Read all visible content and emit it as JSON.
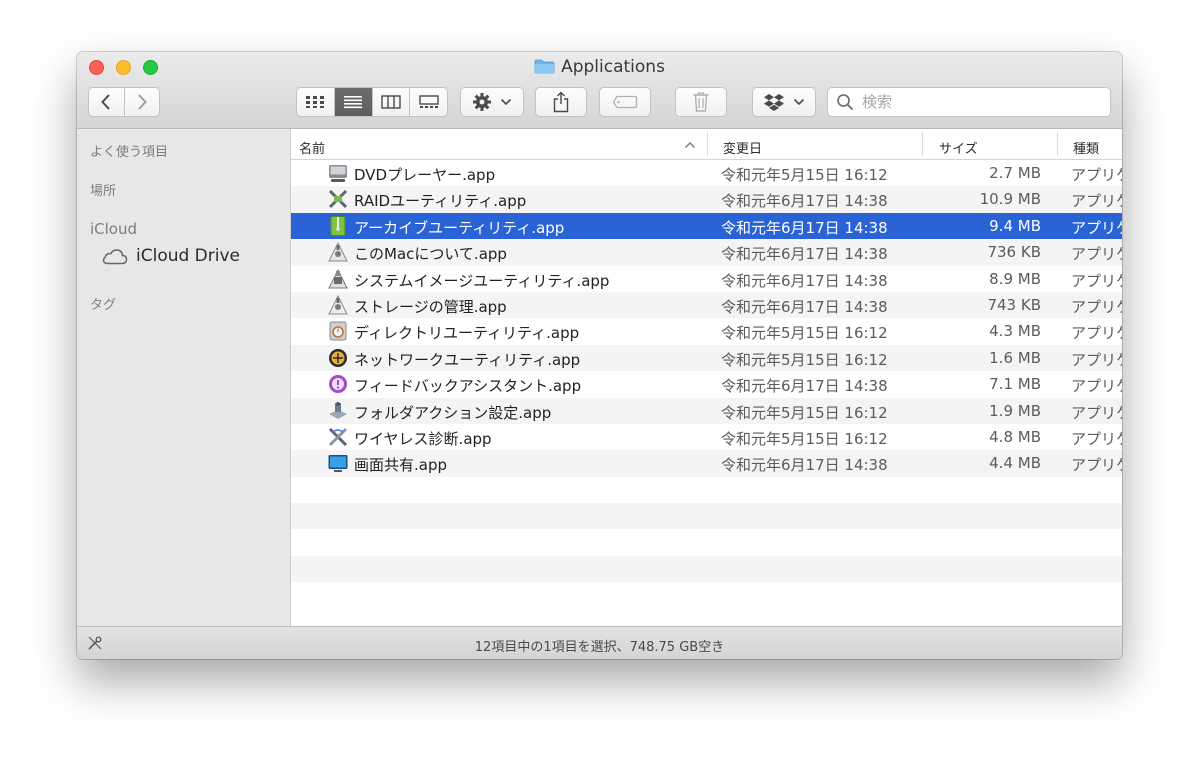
{
  "window": {
    "title": "Applications",
    "folder_icon": "folder-icon"
  },
  "toolbar": {
    "back_icon": "chevron-left-icon",
    "forward_icon": "chevron-right-icon",
    "views": [
      "icon-view-icon",
      "list-view-icon",
      "column-view-icon",
      "gallery-view-icon"
    ],
    "active_view": "list-view-icon",
    "action_icon": "gear-icon",
    "share_icon": "share-icon",
    "tag_icon": "tag-icon",
    "trash_icon": "trash-icon",
    "dropbox_icon": "dropbox-icon",
    "search_placeholder": "検索"
  },
  "sidebar": {
    "favorites_heading": "よく使う項目",
    "locations_heading": "場所",
    "icloud_heading": "iCloud",
    "icloud_drive": "iCloud Drive",
    "tags_heading": "タグ"
  },
  "columns": {
    "name": "名前",
    "modified": "変更日",
    "size": "サイズ",
    "kind": "種類"
  },
  "files": [
    {
      "name": "DVDプレーヤー.app",
      "modified": "令和元年5月15日 16:12",
      "size": "2.7 MB",
      "kind": "アプリケーション",
      "icon": "dvd-player-icon",
      "selected": false
    },
    {
      "name": "RAIDユーティリティ.app",
      "modified": "令和元年6月17日 14:38",
      "size": "10.9 MB",
      "kind": "アプリケーション",
      "icon": "raid-utility-icon",
      "selected": false
    },
    {
      "name": "アーカイブユーティリティ.app",
      "modified": "令和元年6月17日 14:38",
      "size": "9.4 MB",
      "kind": "アプリケーション",
      "icon": "archive-utility-icon",
      "selected": true
    },
    {
      "name": "このMacについて.app",
      "modified": "令和元年6月17日 14:38",
      "size": "736 KB",
      "kind": "アプリケーション",
      "icon": "about-this-mac-icon",
      "selected": false
    },
    {
      "name": "システムイメージユーティリティ.app",
      "modified": "令和元年6月17日 14:38",
      "size": "8.9 MB",
      "kind": "アプリケーション",
      "icon": "system-image-utility-icon",
      "selected": false
    },
    {
      "name": "ストレージの管理.app",
      "modified": "令和元年6月17日 14:38",
      "size": "743 KB",
      "kind": "アプリケーション",
      "icon": "storage-management-icon",
      "selected": false
    },
    {
      "name": "ディレクトリユーティリティ.app",
      "modified": "令和元年5月15日 16:12",
      "size": "4.3 MB",
      "kind": "アプリケーション",
      "icon": "directory-utility-icon",
      "selected": false
    },
    {
      "name": "ネットワークユーティリティ.app",
      "modified": "令和元年5月15日 16:12",
      "size": "1.6 MB",
      "kind": "アプリケーション",
      "icon": "network-utility-icon",
      "selected": false
    },
    {
      "name": "フィードバックアシスタント.app",
      "modified": "令和元年6月17日 14:38",
      "size": "7.1 MB",
      "kind": "アプリケーション",
      "icon": "feedback-assistant-icon",
      "selected": false
    },
    {
      "name": "フォルダアクション設定.app",
      "modified": "令和元年5月15日 16:12",
      "size": "1.9 MB",
      "kind": "アプリケーション",
      "icon": "folder-actions-setup-icon",
      "selected": false
    },
    {
      "name": "ワイヤレス診断.app",
      "modified": "令和元年5月15日 16:12",
      "size": "4.8 MB",
      "kind": "アプリケーション",
      "icon": "wireless-diagnostics-icon",
      "selected": false
    },
    {
      "name": "画面共有.app",
      "modified": "令和元年6月17日 14:38",
      "size": "4.4 MB",
      "kind": "アプリケーション",
      "icon": "screen-sharing-icon",
      "selected": false
    }
  ],
  "status": {
    "text": "12項目中の1項目を選択、748.75 GB空き",
    "icon": "wrench-icon"
  },
  "colors": {
    "selection": "#2a63d6",
    "stripe": "#f4f4f5",
    "sidebar": "#e8e6e7"
  }
}
